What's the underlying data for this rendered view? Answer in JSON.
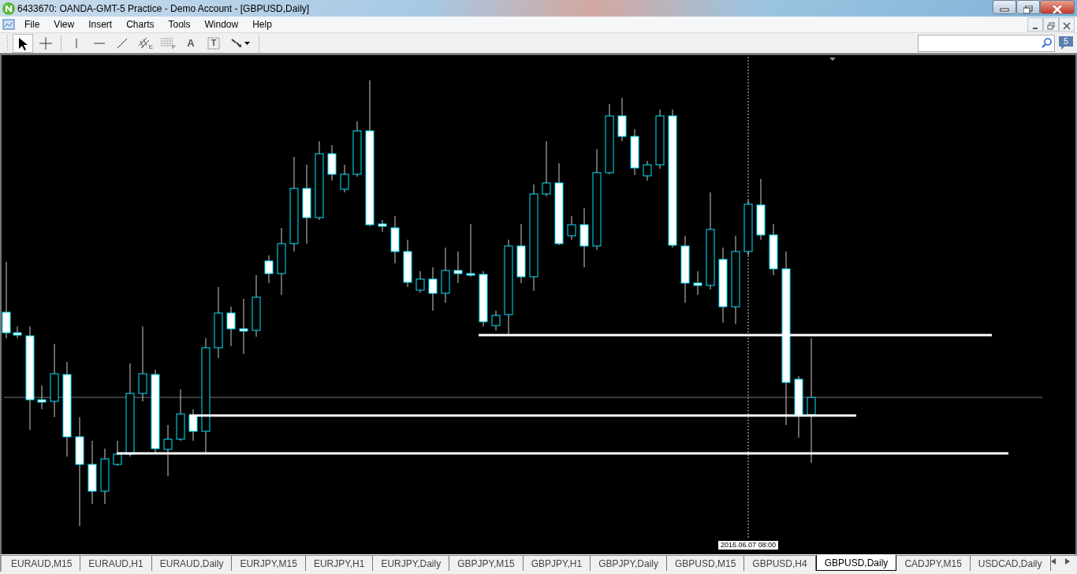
{
  "window": {
    "title": "6433670: OANDA-GMT-5 Practice - Demo Account - [GBPUSD,Daily]"
  },
  "menu": [
    "File",
    "View",
    "Insert",
    "Charts",
    "Tools",
    "Window",
    "Help"
  ],
  "toolbar": [
    {
      "kind": "cursor",
      "selected": true
    },
    {
      "kind": "crosshair",
      "selected": false
    },
    {
      "kind": "vline",
      "selected": false
    },
    {
      "kind": "hline",
      "selected": false
    },
    {
      "kind": "trend",
      "selected": false
    },
    {
      "kind": "channel",
      "selected": false,
      "glyph": "E"
    },
    {
      "kind": "fibo",
      "selected": false,
      "glyph": "F"
    },
    {
      "kind": "text",
      "selected": false,
      "glyph": "A"
    },
    {
      "kind": "label",
      "selected": false,
      "glyph": "T"
    },
    {
      "kind": "arrows",
      "selected": false
    }
  ],
  "notifications": {
    "count": "5"
  },
  "chart": {
    "crosshair_time": "2016.06.07 08:00"
  },
  "tabs": [
    {
      "label": "EURAUD,M15",
      "selected": false
    },
    {
      "label": "EURAUD,H1",
      "selected": false
    },
    {
      "label": "EURAUD,Daily",
      "selected": false
    },
    {
      "label": "EURJPY,M15",
      "selected": false
    },
    {
      "label": "EURJPY,H1",
      "selected": false
    },
    {
      "label": "EURJPY,Daily",
      "selected": false
    },
    {
      "label": "GBPJPY,M15",
      "selected": false
    },
    {
      "label": "GBPJPY,H1",
      "selected": false
    },
    {
      "label": "GBPJPY,Daily",
      "selected": false
    },
    {
      "label": "GBPUSD,M15",
      "selected": false
    },
    {
      "label": "GBPUSD,H4",
      "selected": false
    },
    {
      "label": "GBPUSD,Daily",
      "selected": true
    },
    {
      "label": "CADJPY,M15",
      "selected": false
    },
    {
      "label": "USDCAD,Daily",
      "selected": false
    }
  ]
}
